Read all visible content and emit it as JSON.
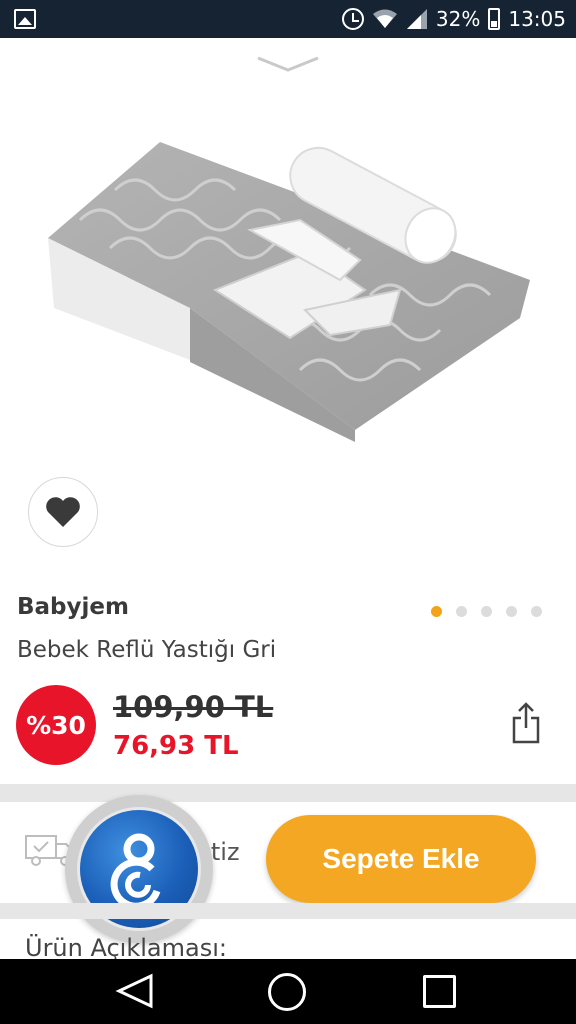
{
  "status_bar": {
    "battery": "32%",
    "time": "13:05"
  },
  "product": {
    "brand": "Babyjem",
    "name": "Bebek Reflü Yastığı Gri",
    "discount": "%30",
    "old_price": "109,90 TL",
    "new_price": "76,93 TL",
    "image_count": 5,
    "active_image": 1
  },
  "shipping": {
    "text": "Ücretiz"
  },
  "actions": {
    "add_to_cart": "Sepete Ekle"
  },
  "sections": {
    "description_label": "Ürün Açıklaması:"
  },
  "colors": {
    "accent": "#f3a722",
    "discount": "#e8152a",
    "status_bar": "#162333"
  }
}
